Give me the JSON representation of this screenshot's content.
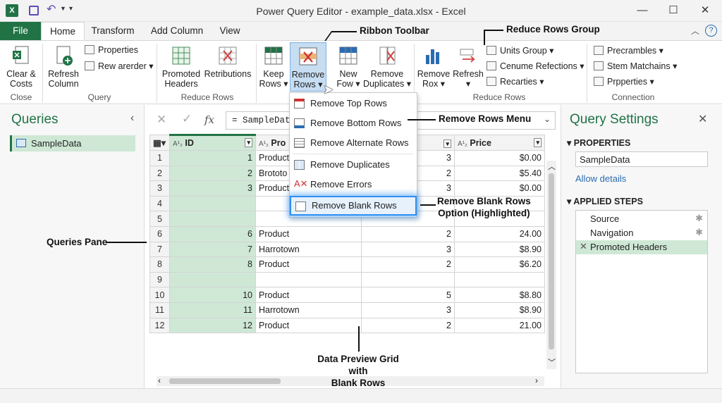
{
  "window": {
    "title": "Power Query Editor - example_data.xlsx - Excel"
  },
  "tabs": [
    "File",
    "Home",
    "Transform",
    "Add Column",
    "View"
  ],
  "ribbon": {
    "close_group": {
      "button": "Clear &\nCosts",
      "label": "Close"
    },
    "query_group": {
      "refresh": "Refresh\nColumn",
      "properties": "Properties",
      "reorder": "Rew arerder",
      "label": "Query"
    },
    "reduce_rows_group": {
      "promoted": "Promoted\nHeaders",
      "retributions": "Retributions",
      "keep_rows": "Keep\nRows",
      "remove_rows": "Remove\nRows",
      "label": "Reduce Rows"
    },
    "group2": {
      "new_row": "New\nFow",
      "remove_duplicates": "Remove\nDuplicates",
      "remove_rox": "Remove\nRox",
      "refresh": "Refresh",
      "units_group": "Units Group",
      "cenume": "Cenume Refections",
      "recarties": "Recarties",
      "label": "Reduce Rows"
    },
    "connection_group": {
      "precrambles": "Precrambles",
      "stem": "Stem Matchains",
      "properties": "Prpperties",
      "label": "Connection"
    }
  },
  "formula": {
    "text": "= SampleDat",
    "fx": "fx"
  },
  "queries_pane": {
    "title": "Queries",
    "items": [
      "SampleData"
    ]
  },
  "grid": {
    "headers": [
      "ID",
      "Pro",
      "",
      "Price"
    ],
    "header_types": [
      "A¹₂",
      "A¹₂",
      "",
      "A¹₂"
    ],
    "rows": [
      {
        "n": "1",
        "id": "1",
        "product": "Product",
        "q": "3",
        "price": "$0.00"
      },
      {
        "n": "2",
        "id": "2",
        "product": "Brototo",
        "q": "2",
        "price": "$5.40"
      },
      {
        "n": "3",
        "id": "3",
        "product": "Product",
        "q": "3",
        "price": "$0.00"
      },
      {
        "n": "4",
        "id": "",
        "product": "",
        "q": "",
        "price": ""
      },
      {
        "n": "5",
        "id": "",
        "product": "",
        "q": "",
        "price": ""
      },
      {
        "n": "6",
        "id": "6",
        "product": "Product",
        "q": "2",
        "price": "24.00"
      },
      {
        "n": "7",
        "id": "7",
        "product": "Harrotown",
        "q": "3",
        "price": "$8.90"
      },
      {
        "n": "8",
        "id": "8",
        "product": "Product",
        "q": "2",
        "price": "$6.20"
      },
      {
        "n": "9",
        "id": "",
        "product": "",
        "q": "",
        "price": ""
      },
      {
        "n": "10",
        "id": "10",
        "product": "Product",
        "q": "5",
        "price": "$8.80"
      },
      {
        "n": "11",
        "id": "11",
        "product": "Harrotown",
        "q": "3",
        "price": "$8.90"
      },
      {
        "n": "12",
        "id": "12",
        "product": "Product",
        "q": "2",
        "price": "21.00"
      }
    ]
  },
  "remove_rows_menu": {
    "items": [
      "Remove Top Rows",
      "Remove Bottom Rows",
      "Remove Alternate Rows",
      "Remove Duplicates",
      "Remove Errors",
      "Remove Blank Rows"
    ],
    "highlighted": "Remove Blank Rows"
  },
  "query_settings": {
    "title": "Query Settings",
    "properties_label": "PROPERTIES",
    "name": "SampleData",
    "allow_details": "Allow details",
    "applied_steps_label": "APPLIED STEPS",
    "steps": [
      "Source",
      "Navigation",
      "Promoted Headers"
    ]
  },
  "annotations": {
    "ribbon_toolbar": "Ribbon Toolbar",
    "reduce_rows_group": "Reduce Rows Group",
    "remove_rows_menu": "Remove Rows Menu",
    "remove_blank": "Remove Blank Rows\nOption (Highlighted)",
    "queries_pane": "Queries Pane",
    "data_preview": "Data Preview Grid with\nBlank Rows"
  },
  "colors": {
    "excel_green": "#217346",
    "highlight_blue": "#2f8ff0",
    "id_column": "#cfe8d6"
  }
}
